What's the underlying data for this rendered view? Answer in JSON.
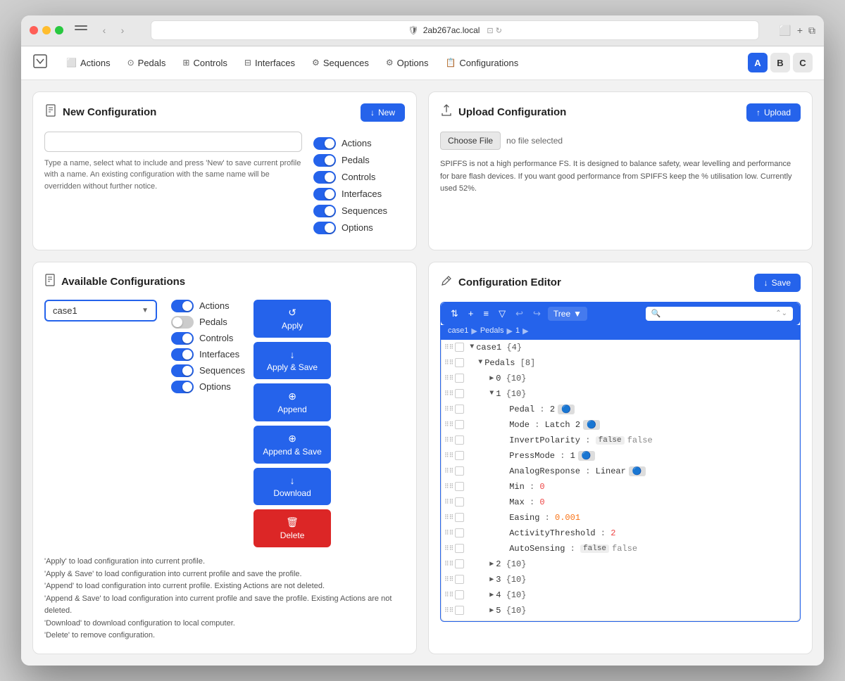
{
  "browser": {
    "url": "2ab267ac.local"
  },
  "nav": {
    "items": [
      {
        "label": "Actions",
        "icon": "⬜"
      },
      {
        "label": "Pedals",
        "icon": "⊙"
      },
      {
        "label": "Controls",
        "icon": "⊞"
      },
      {
        "label": "Interfaces",
        "icon": "⊟"
      },
      {
        "label": "Sequences",
        "icon": "⚙"
      },
      {
        "label": "Options",
        "icon": "⚙"
      },
      {
        "label": "Configurations",
        "icon": "📋"
      }
    ],
    "badges": [
      "A",
      "B",
      "C"
    ]
  },
  "newConfig": {
    "title": "New Configuration",
    "button": "New",
    "placeholder": "",
    "helpText": "Type a name, select what to include and press 'New' to save current profile with a name. An existing configuration with the same name will be overridden without further notice.",
    "toggles": [
      {
        "label": "Actions",
        "on": true
      },
      {
        "label": "Pedals",
        "on": true
      },
      {
        "label": "Controls",
        "on": true
      },
      {
        "label": "Interfaces",
        "on": true
      },
      {
        "label": "Sequences",
        "on": true
      },
      {
        "label": "Options",
        "on": true
      }
    ]
  },
  "uploadConfig": {
    "title": "Upload Configuration",
    "button": "Upload",
    "chooseFile": "Choose File",
    "noFile": "no file selected",
    "info": "SPIFFS is not a high performance FS. It is designed to balance safety, wear levelling and performance for bare flash devices. If you want good performance from SPIFFS keep the % utilisation low. Currently used 52%."
  },
  "availConfig": {
    "title": "Available Configurations",
    "selectedConfig": "case1",
    "description": "'Apply' to load configuration into current profile.\n'Apply & Save' to load configuration into current profile and save the profile.\n'Append' to load configuration into current profile. Existing Actions are not deleted.\n'Append & Save' to load configuration into current profile and save the profile. Existing Actions are not deleted.\n'Download' to download configuration to local computer.\n'Delete' to remove configuration.",
    "toggles": [
      {
        "label": "Actions",
        "on": true
      },
      {
        "label": "Pedals",
        "on": false
      },
      {
        "label": "Controls",
        "on": true
      },
      {
        "label": "Interfaces",
        "on": true
      },
      {
        "label": "Sequences",
        "on": true
      },
      {
        "label": "Options",
        "on": true
      }
    ],
    "buttons": [
      {
        "label": "Apply",
        "icon": "↺",
        "red": false
      },
      {
        "label": "Apply & Save",
        "icon": "↓",
        "red": false
      },
      {
        "label": "Append",
        "icon": "+",
        "red": false
      },
      {
        "label": "Append & Save",
        "icon": "+",
        "red": false
      },
      {
        "label": "Download",
        "icon": "↓",
        "red": false
      },
      {
        "label": "Delete",
        "icon": "🗑",
        "red": true
      }
    ]
  },
  "configEditor": {
    "title": "Configuration Editor",
    "saveButton": "Save",
    "treeLabel": "Tree",
    "searchPlaceholder": "",
    "breadcrumb": [
      "case1",
      "Pedals",
      "1"
    ],
    "treeData": {
      "root": "case1",
      "rootCount": 4,
      "children": [
        {
          "key": "Pedals",
          "count": 8,
          "expanded": true,
          "children": [
            {
              "index": 0,
              "count": 10,
              "expanded": false
            },
            {
              "index": 1,
              "count": 10,
              "expanded": true,
              "fields": [
                {
                  "key": "Pedal",
                  "value": "2",
                  "type": "badge-num"
                },
                {
                  "key": "Mode",
                  "value": "Latch 2",
                  "type": "badge-str"
                },
                {
                  "key": "InvertPolarity",
                  "value": "false",
                  "type": "false"
                },
                {
                  "key": "PressMode",
                  "value": "1",
                  "type": "badge-num2"
                },
                {
                  "key": "AnalogResponse",
                  "value": "Linear",
                  "type": "badge-str2"
                },
                {
                  "key": "Min",
                  "value": "0",
                  "type": "red-num"
                },
                {
                  "key": "Max",
                  "value": "0",
                  "type": "red-num"
                },
                {
                  "key": "Easing",
                  "value": "0.001",
                  "type": "orange-num"
                },
                {
                  "key": "ActivityThreshold",
                  "value": "2",
                  "type": "plain-num"
                },
                {
                  "key": "AutoSensing",
                  "value": "false",
                  "type": "false"
                }
              ]
            },
            {
              "index": 2,
              "count": 10,
              "expanded": false
            },
            {
              "index": 3,
              "count": 10,
              "expanded": false
            },
            {
              "index": 4,
              "count": 10,
              "expanded": false
            },
            {
              "index": 5,
              "count": 10,
              "expanded": false
            }
          ]
        }
      ]
    }
  }
}
